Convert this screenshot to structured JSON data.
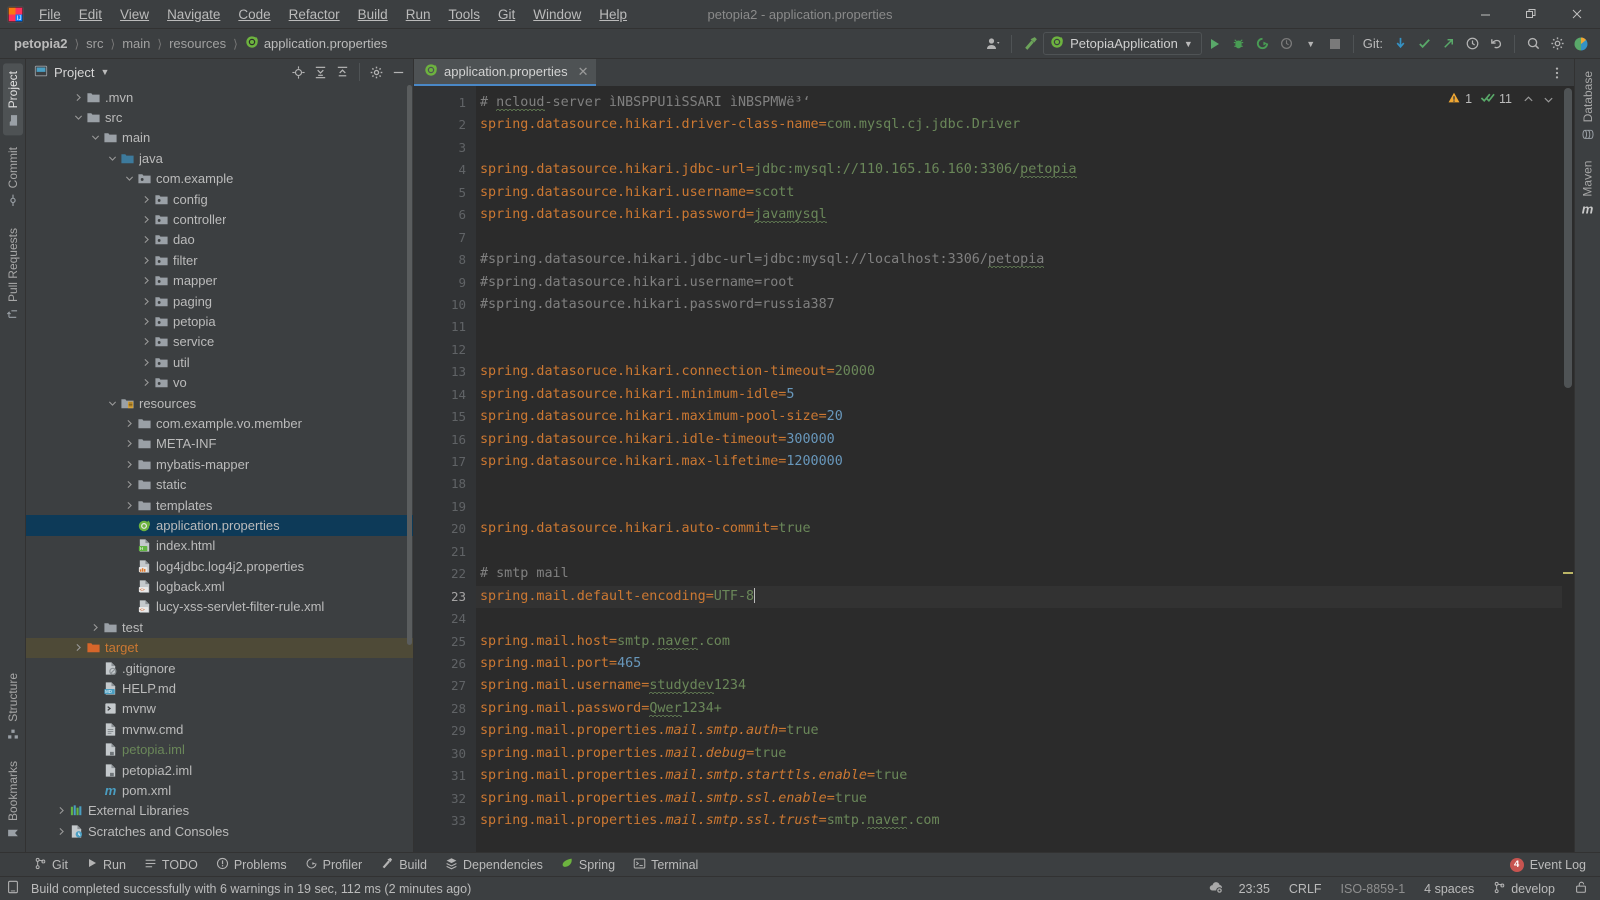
{
  "window": {
    "title": "petopia2 - application.properties",
    "controls": {
      "minimize": "—",
      "maximize": "❐",
      "close": "✕"
    }
  },
  "menu": [
    {
      "label": "File"
    },
    {
      "label": "Edit"
    },
    {
      "label": "View"
    },
    {
      "label": "Navigate"
    },
    {
      "label": "Code"
    },
    {
      "label": "Refactor"
    },
    {
      "label": "Build"
    },
    {
      "label": "Run"
    },
    {
      "label": "Tools"
    },
    {
      "label": "Git"
    },
    {
      "label": "Window"
    },
    {
      "label": "Help"
    }
  ],
  "breadcrumb": [
    {
      "label": "petopia2",
      "style": "bold"
    },
    {
      "label": "src",
      "style": "dim"
    },
    {
      "label": "main",
      "style": "dim"
    },
    {
      "label": "resources",
      "style": "dim"
    },
    {
      "label": "application.properties",
      "style": "file"
    }
  ],
  "toolbar": {
    "run_config": "PetopiaApplication",
    "git_label": "Git:",
    "icons": [
      "user-avatar-icon",
      "chevron-down-icon",
      "hammer-build-icon",
      "run-icon",
      "debug-icon",
      "run-with-coverage-icon",
      "profiler-icon",
      "stop-icon",
      "update-project-icon",
      "commit-icon",
      "push-icon",
      "history-icon",
      "rollback-icon",
      "search-everywhere-icon",
      "settings-gear-icon",
      "ide-assistant-icon"
    ]
  },
  "left_strip": {
    "top": [
      {
        "label": "Project",
        "icon": "project-icon",
        "active": true
      },
      {
        "label": "Commit",
        "icon": "commit-icon",
        "active": false
      },
      {
        "label": "Pull Requests",
        "icon": "pull-request-icon",
        "active": false
      }
    ],
    "bottom": [
      {
        "label": "Structure",
        "icon": "structure-icon",
        "active": false
      },
      {
        "label": "Bookmarks",
        "icon": "bookmark-icon",
        "active": false
      }
    ]
  },
  "right_strip": {
    "items": [
      {
        "label": "Database",
        "icon": "database-icon"
      },
      {
        "label": "Maven",
        "icon": "maven-icon"
      }
    ]
  },
  "project_panel": {
    "title": "Project",
    "header_icons": [
      "locate-icon",
      "expand-all-icon",
      "collapse-all-icon",
      "settings-gear-icon",
      "hide-icon"
    ],
    "tree": [
      {
        "indent": 2,
        "arrow": "right",
        "icon": "folder",
        "label": ".mvn"
      },
      {
        "indent": 2,
        "arrow": "down",
        "icon": "folder",
        "label": "src"
      },
      {
        "indent": 3,
        "arrow": "down",
        "icon": "folder",
        "label": "main"
      },
      {
        "indent": 4,
        "arrow": "down",
        "icon": "folder-source",
        "label": "java"
      },
      {
        "indent": 5,
        "arrow": "down",
        "icon": "package",
        "label": "com.example"
      },
      {
        "indent": 6,
        "arrow": "right",
        "icon": "package",
        "label": "config"
      },
      {
        "indent": 6,
        "arrow": "right",
        "icon": "package",
        "label": "controller"
      },
      {
        "indent": 6,
        "arrow": "right",
        "icon": "package",
        "label": "dao"
      },
      {
        "indent": 6,
        "arrow": "right",
        "icon": "package",
        "label": "filter"
      },
      {
        "indent": 6,
        "arrow": "right",
        "icon": "package",
        "label": "mapper"
      },
      {
        "indent": 6,
        "arrow": "right",
        "icon": "package",
        "label": "paging"
      },
      {
        "indent": 6,
        "arrow": "right",
        "icon": "package",
        "label": "petopia"
      },
      {
        "indent": 6,
        "arrow": "right",
        "icon": "package",
        "label": "service"
      },
      {
        "indent": 6,
        "arrow": "right",
        "icon": "package",
        "label": "util"
      },
      {
        "indent": 6,
        "arrow": "right",
        "icon": "package",
        "label": "vo"
      },
      {
        "indent": 4,
        "arrow": "down",
        "icon": "folder-resource",
        "label": "resources"
      },
      {
        "indent": 5,
        "arrow": "right",
        "icon": "folder",
        "label": "com.example.vo.member"
      },
      {
        "indent": 5,
        "arrow": "right",
        "icon": "folder",
        "label": "META-INF"
      },
      {
        "indent": 5,
        "arrow": "right",
        "icon": "folder",
        "label": "mybatis-mapper"
      },
      {
        "indent": 5,
        "arrow": "right",
        "icon": "folder",
        "label": "static"
      },
      {
        "indent": 5,
        "arrow": "right",
        "icon": "folder",
        "label": "templates"
      },
      {
        "indent": 5,
        "arrow": "none",
        "icon": "spring-file",
        "label": "application.properties",
        "state": "selected"
      },
      {
        "indent": 5,
        "arrow": "none",
        "icon": "html-file",
        "label": "index.html"
      },
      {
        "indent": 5,
        "arrow": "none",
        "icon": "props-file",
        "label": "log4jdbc.log4j2.properties"
      },
      {
        "indent": 5,
        "arrow": "none",
        "icon": "xml-file",
        "label": "logback.xml"
      },
      {
        "indent": 5,
        "arrow": "none",
        "icon": "xml-file",
        "label": "lucy-xss-servlet-filter-rule.xml"
      },
      {
        "indent": 3,
        "arrow": "right",
        "icon": "folder",
        "label": "test"
      },
      {
        "indent": 2,
        "arrow": "right",
        "icon": "folder-excluded",
        "label": "target",
        "state": "highlight",
        "color": "orange"
      },
      {
        "indent": 3,
        "arrow": "none",
        "icon": "gitignore-file",
        "label": ".gitignore"
      },
      {
        "indent": 3,
        "arrow": "none",
        "icon": "md-file",
        "label": "HELP.md"
      },
      {
        "indent": 3,
        "arrow": "none",
        "icon": "sh-file",
        "label": "mvnw"
      },
      {
        "indent": 3,
        "arrow": "none",
        "icon": "cmd-file",
        "label": "mvnw.cmd"
      },
      {
        "indent": 3,
        "arrow": "none",
        "icon": "iml-file",
        "label": "petopia.iml",
        "color": "green"
      },
      {
        "indent": 3,
        "arrow": "none",
        "icon": "iml-file",
        "label": "petopia2.iml"
      },
      {
        "indent": 3,
        "arrow": "none",
        "icon": "maven-file",
        "label": "pom.xml"
      },
      {
        "indent": 1,
        "arrow": "right",
        "icon": "libraries",
        "label": "External Libraries"
      },
      {
        "indent": 1,
        "arrow": "right",
        "icon": "scratches",
        "label": "Scratches and Consoles"
      }
    ]
  },
  "editor": {
    "tab": {
      "label": "application.properties",
      "icon": "spring-file",
      "close": "✕"
    },
    "inspection": {
      "warning_count": "1",
      "weak_count": "11",
      "warning_icon": "warning-triangle-icon",
      "ok_icon": "inspection-check-icon",
      "up_icon": "chevron-up-icon"
    },
    "first_line_number": 1,
    "current_line": 23,
    "lines": [
      {
        "n": 1,
        "segments": [
          {
            "t": "# ",
            "c": "cmt"
          },
          {
            "t": "ncloud",
            "c": "cmt sq"
          },
          {
            "t": "-server ìNBSPPU1ìSSARI ìNBSPMWë³‘",
            "c": "cmt"
          }
        ]
      },
      {
        "n": 2,
        "segments": [
          {
            "t": "spring.datasource.hikari.driver-class-name",
            "c": "k"
          },
          {
            "t": "=",
            "c": "k"
          },
          {
            "t": "com.mysql.cj.jdbc.Driver",
            "c": "v"
          }
        ]
      },
      {
        "n": 3,
        "segments": []
      },
      {
        "n": 4,
        "segments": [
          {
            "t": "spring.datasource.hikari.jdbc-url",
            "c": "k"
          },
          {
            "t": "=",
            "c": "k"
          },
          {
            "t": "jdbc:mysql://110.165.16.160:3306/",
            "c": "v"
          },
          {
            "t": "petopia",
            "c": "v sq"
          }
        ]
      },
      {
        "n": 5,
        "segments": [
          {
            "t": "spring.datasource.hikari.username",
            "c": "k"
          },
          {
            "t": "=",
            "c": "k"
          },
          {
            "t": "scott",
            "c": "v"
          }
        ]
      },
      {
        "n": 6,
        "segments": [
          {
            "t": "spring.datasource.hikari.password",
            "c": "k"
          },
          {
            "t": "=",
            "c": "k"
          },
          {
            "t": "javamysql",
            "c": "v sq"
          }
        ]
      },
      {
        "n": 7,
        "segments": []
      },
      {
        "n": 8,
        "segments": [
          {
            "t": "#spring.datasource.hikari.jdbc-url=jdbc:mysql://localhost:3306/",
            "c": "cmt"
          },
          {
            "t": "petopia",
            "c": "cmt sq"
          }
        ]
      },
      {
        "n": 9,
        "segments": [
          {
            "t": "#spring.datasource.hikari.username=root",
            "c": "cmt"
          }
        ]
      },
      {
        "n": 10,
        "segments": [
          {
            "t": "#spring.datasource.hikari.password=russia387",
            "c": "cmt"
          }
        ]
      },
      {
        "n": 11,
        "segments": []
      },
      {
        "n": 12,
        "segments": []
      },
      {
        "n": 13,
        "segments": [
          {
            "t": "spring.datasoruce.hikari.connection-timeout",
            "c": "k"
          },
          {
            "t": "=",
            "c": "k"
          },
          {
            "t": "20000",
            "c": "v"
          }
        ]
      },
      {
        "n": 14,
        "segments": [
          {
            "t": "spring.datasource.hikari.minimum-idle",
            "c": "k"
          },
          {
            "t": "=",
            "c": "k"
          },
          {
            "t": "5",
            "c": "n"
          }
        ]
      },
      {
        "n": 15,
        "segments": [
          {
            "t": "spring.datasource.hikari.maximum-pool-size",
            "c": "k"
          },
          {
            "t": "=",
            "c": "k"
          },
          {
            "t": "20",
            "c": "n"
          }
        ]
      },
      {
        "n": 16,
        "segments": [
          {
            "t": "spring.datasource.hikari.idle-timeout",
            "c": "k"
          },
          {
            "t": "=",
            "c": "k"
          },
          {
            "t": "300000",
            "c": "n"
          }
        ]
      },
      {
        "n": 17,
        "segments": [
          {
            "t": "spring.datasource.hikari.max-lifetime",
            "c": "k"
          },
          {
            "t": "=",
            "c": "k"
          },
          {
            "t": "1200000",
            "c": "n"
          }
        ]
      },
      {
        "n": 18,
        "segments": []
      },
      {
        "n": 19,
        "segments": []
      },
      {
        "n": 20,
        "segments": [
          {
            "t": "spring.datasource.hikari.auto-commit",
            "c": "k"
          },
          {
            "t": "=",
            "c": "k"
          },
          {
            "t": "true",
            "c": "v"
          }
        ]
      },
      {
        "n": 21,
        "segments": []
      },
      {
        "n": 22,
        "segments": [
          {
            "t": "# smtp mail",
            "c": "cmt"
          }
        ]
      },
      {
        "n": 23,
        "segments": [
          {
            "t": "spring.mail.default-encoding",
            "c": "k"
          },
          {
            "t": "=",
            "c": "k"
          },
          {
            "t": "UTF-8",
            "c": "v"
          }
        ],
        "current": true
      },
      {
        "n": 24,
        "segments": []
      },
      {
        "n": 25,
        "segments": [
          {
            "t": "spring.mail.host",
            "c": "k"
          },
          {
            "t": "=",
            "c": "k"
          },
          {
            "t": "smtp.",
            "c": "v"
          },
          {
            "t": "naver",
            "c": "v sq"
          },
          {
            "t": ".com",
            "c": "v"
          }
        ]
      },
      {
        "n": 26,
        "segments": [
          {
            "t": "spring.mail.port",
            "c": "k"
          },
          {
            "t": "=",
            "c": "k"
          },
          {
            "t": "465",
            "c": "n"
          }
        ]
      },
      {
        "n": 27,
        "segments": [
          {
            "t": "spring.mail.username",
            "c": "k"
          },
          {
            "t": "=",
            "c": "k"
          },
          {
            "t": "studydev",
            "c": "v sq"
          },
          {
            "t": "1234",
            "c": "v"
          }
        ]
      },
      {
        "n": 28,
        "segments": [
          {
            "t": "spring.mail.password",
            "c": "k"
          },
          {
            "t": "=",
            "c": "k"
          },
          {
            "t": "Qwer",
            "c": "v sq"
          },
          {
            "t": "1234+",
            "c": "v"
          }
        ]
      },
      {
        "n": 29,
        "segments": [
          {
            "t": "spring.mail.properties.",
            "c": "k"
          },
          {
            "t": "mail.smtp.auth",
            "c": "ital"
          },
          {
            "t": "=",
            "c": "k"
          },
          {
            "t": "true",
            "c": "v"
          }
        ]
      },
      {
        "n": 30,
        "segments": [
          {
            "t": "spring.mail.properties.",
            "c": "k"
          },
          {
            "t": "mail.debug",
            "c": "ital"
          },
          {
            "t": "=",
            "c": "k"
          },
          {
            "t": "true",
            "c": "v"
          }
        ]
      },
      {
        "n": 31,
        "segments": [
          {
            "t": "spring.mail.properties.",
            "c": "k"
          },
          {
            "t": "mail.smtp.starttls.enable",
            "c": "ital"
          },
          {
            "t": "=",
            "c": "k"
          },
          {
            "t": "true",
            "c": "v"
          }
        ]
      },
      {
        "n": 32,
        "segments": [
          {
            "t": "spring.mail.properties.",
            "c": "k"
          },
          {
            "t": "mail.smtp.ssl.enable",
            "c": "ital"
          },
          {
            "t": "=",
            "c": "k"
          },
          {
            "t": "true",
            "c": "v"
          }
        ]
      },
      {
        "n": 33,
        "segments": [
          {
            "t": "spring.mail.properties.",
            "c": "k"
          },
          {
            "t": "mail.smtp.ssl.trust",
            "c": "ital"
          },
          {
            "t": "=",
            "c": "k"
          },
          {
            "t": "smtp.",
            "c": "v"
          },
          {
            "t": "naver",
            "c": "v sq"
          },
          {
            "t": ".com",
            "c": "v"
          }
        ]
      }
    ]
  },
  "bottom_bar": {
    "tabs": [
      {
        "label": "Git",
        "icon": "git-branch-icon"
      },
      {
        "label": "Run",
        "icon": "run-icon"
      },
      {
        "label": "TODO",
        "icon": "todo-icon"
      },
      {
        "label": "Problems",
        "icon": "problems-icon"
      },
      {
        "label": "Profiler",
        "icon": "profiler-icon"
      },
      {
        "label": "Build",
        "icon": "build-hammer-icon"
      },
      {
        "label": "Dependencies",
        "icon": "dependencies-icon"
      },
      {
        "label": "Spring",
        "icon": "spring-leaf-icon"
      },
      {
        "label": "Terminal",
        "icon": "terminal-icon"
      }
    ],
    "event_log": {
      "label": "Event Log",
      "count": "4"
    }
  },
  "status_bar": {
    "message": "Build completed successfully with 6 warnings in 19 sec, 112 ms (2 minutes ago)",
    "message_icon": "build-status-icon",
    "right": {
      "cloud_icon": "cloud-sync-icon",
      "position": "23:35",
      "line_separator": "CRLF",
      "encoding": "ISO-8859-1",
      "indent": "4 spaces",
      "branch": "develop",
      "branch_icon": "git-branch-icon",
      "lock_icon": "read-write-lock-icon"
    }
  },
  "colors": {
    "background": "#3c3f41",
    "editor_bg": "#2b2b2b",
    "gutter_bg": "#313335",
    "selection": "#0d3a58",
    "key": "#cc7832",
    "value": "#6a8759",
    "number": "#6897bb",
    "comment": "#808080",
    "accent": "#4a88c7",
    "badge_red": "#c75450"
  }
}
